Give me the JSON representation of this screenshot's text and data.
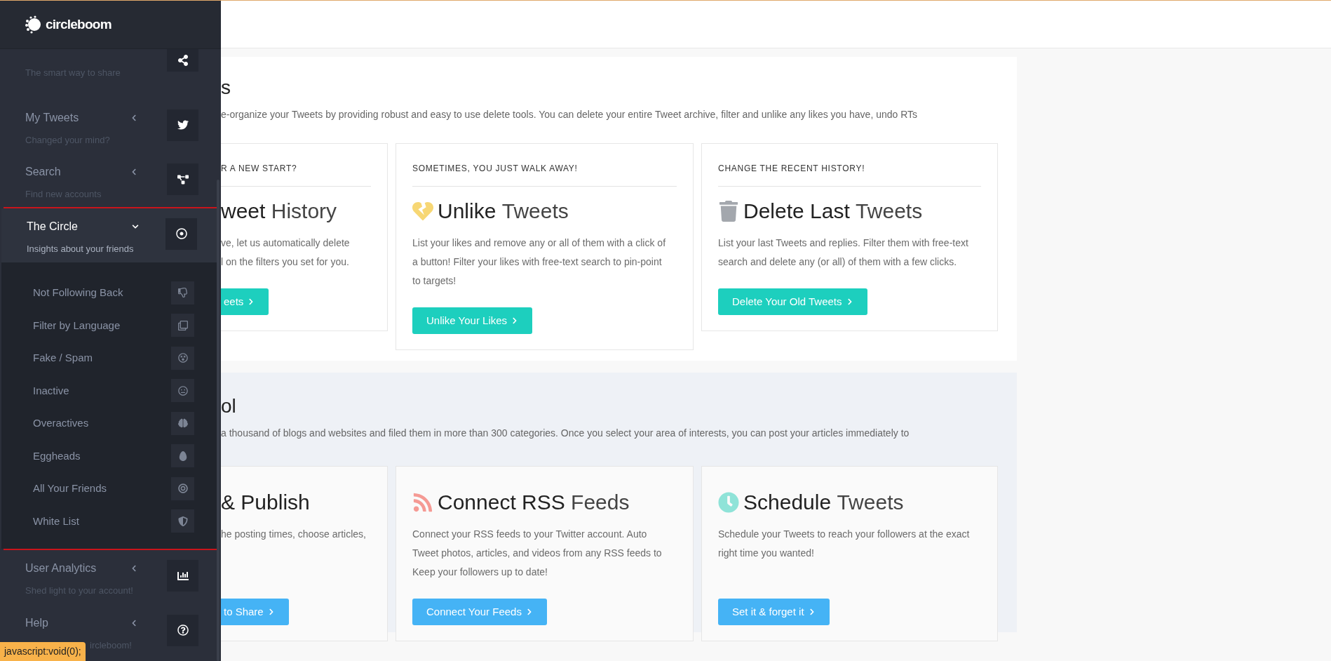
{
  "sidebar": {
    "logo": "circleboom",
    "items": [
      {
        "subtitle": "The smart way to share",
        "selected": false
      },
      {
        "title": "My Tweets",
        "subtitle": "Changed your mind?",
        "expanded": false,
        "selected": false
      },
      {
        "title": "Search",
        "subtitle": "Find new accounts",
        "expanded": false,
        "selected": false
      },
      {
        "title": "The Circle",
        "subtitle": "Insights about your friends",
        "expanded": true,
        "selected": true,
        "children": [
          {
            "label": "Not Following Back"
          },
          {
            "label": "Filter by Language"
          },
          {
            "label": "Fake / Spam"
          },
          {
            "label": "Inactive"
          },
          {
            "label": "Overactives"
          },
          {
            "label": "Eggheads"
          },
          {
            "label": "All Your Friends"
          },
          {
            "label": "White List"
          }
        ]
      },
      {
        "title": "User Analytics",
        "subtitle": "Shed light to your account!",
        "expanded": false,
        "selected": false
      },
      {
        "title": "Help",
        "subtitle": "ircleboom!",
        "expanded": false,
        "selected": false
      }
    ]
  },
  "status_link": "javascript:void(0);",
  "sections": [
    {
      "title": "s",
      "description": "e-organize your Tweets by providing robust and easy to use delete tools. You can delete your entire Tweet archive, filter and unlike any likes you have, undo RTs",
      "cards": [
        {
          "eyebrow": "R A NEW START?",
          "title_strong": "weet",
          "title_rest": "History",
          "body": [
            "ve, let us automatically delete",
            "l on the filters you set for you."
          ],
          "button": "eets"
        },
        {
          "eyebrow": "SOMETIMES, YOU JUST WALK AWAY!",
          "title_strong": "Unlike",
          "title_rest": "Tweets",
          "body": [
            "List your likes and remove any or all of them with a click of",
            "a button! Filter your likes with free-text search to pin-point",
            "to targets!"
          ],
          "button": "Unlike Your Likes"
        },
        {
          "eyebrow": "CHANGE THE RECENT HISTORY!",
          "title_strong": "Delete Last",
          "title_rest": "Tweets",
          "body": [
            "List your last Tweets and replies. Filter them with free-text",
            "search and delete any (or all) of them with a few clicks."
          ],
          "button": "Delete Your Old Tweets"
        }
      ]
    },
    {
      "title": "ol",
      "description": "a thousand of blogs and websites and filed them in more than 300 categories. Once you select your area of interests, you can post your articles immediately to",
      "cards": [
        {
          "title_strong": "& Publish",
          "body": [
            "he posting times, choose articles,"
          ],
          "button": "to Share"
        },
        {
          "title_strong": "Connect RSS",
          "title_rest": "Feeds",
          "body": [
            "Connect your RSS feeds to your Twitter account. Auto",
            "Tweet photos, articles, and videos from any RSS feeds to",
            "Keep your followers up to date!"
          ],
          "button": "Connect Your Feeds"
        },
        {
          "title_strong": "Schedule",
          "title_rest": "Tweets",
          "body": [
            "Schedule your Tweets to reach your followers at the exact",
            "right time you wanted!"
          ],
          "button": "Set it & forget it"
        }
      ]
    }
  ]
}
